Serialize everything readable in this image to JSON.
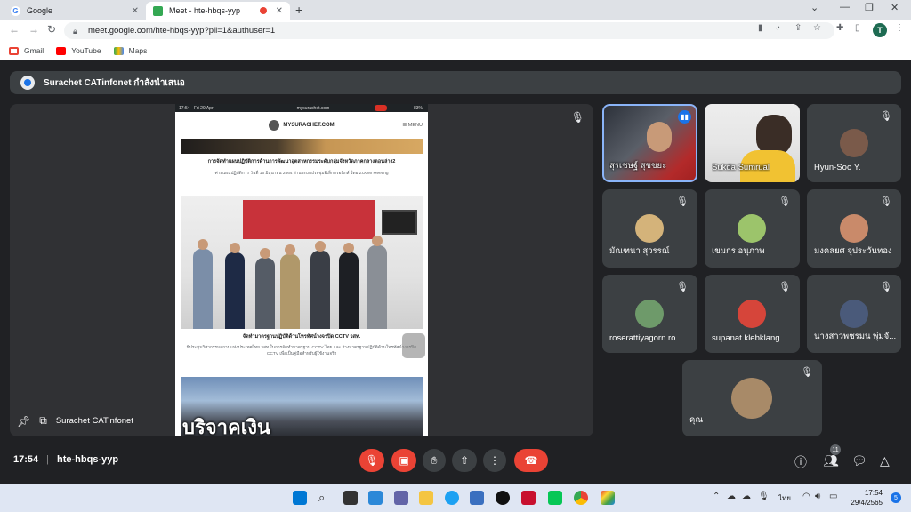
{
  "browser": {
    "tabs": [
      {
        "title": "Google",
        "active": false
      },
      {
        "title": "Meet - hte-hbqs-yyp",
        "active": true
      }
    ],
    "url": "meet.google.com/hte-hbqs-yyp?pli=1&authuser=1",
    "profile_initial": "T",
    "bookmarks": [
      "Gmail",
      "YouTube",
      "Maps"
    ]
  },
  "meet": {
    "presenting_banner": "Surachet CATinfonet กำลังนำเสนอ",
    "presenter_name": "Surachet CATinfonet",
    "shared_screen": {
      "status_time": "17:54 · Fri 29 Apr",
      "status_url": "mysurachet.com",
      "status_battery": "83%",
      "site_name": "MYSURACHET.COM",
      "menu": "MENU",
      "article1_title": "การจัดทำแผนปฏิบัติการด้านการพัฒนาอุตสาหกรรมระดับกลุ่มจังหวัดภาคกลางตอนล่าง2",
      "article1_sub": "ค่ายแผนปฏิบัติการ วันที่ 15 มิถุนายน 2564 ผ่านระบบประชุมอิเล็กทรอนิกส์ โดย ZOOM Meeting",
      "article2_title": "จัดทำมาตรฐานปฏิบัติด้านโทรทัศน์วงจรปิด CCTV วสท.",
      "article2_sub": "ที่ประชุมวิศวกรรมสถานแห่งประเทศไทย วสท.ในการจัดทำมาตรฐาน CCTV ไทย และ ร่างมาตรฐานปฏิบัติด้านโทรทัศน์วงจรปิด CCTV เพื่อเป็นคู่มือสำหรับผู้ใช้งานจริง",
      "banner_caption": "บริจาคเงิน"
    },
    "participants": [
      {
        "name": "สุรเชษฐ์ สุขขยะ",
        "speaking": true,
        "video": true
      },
      {
        "name": "Sukda Sumrual",
        "speaking": false,
        "video": true
      },
      {
        "name": "Hyun-Soo Y.",
        "speaking": false,
        "video": false
      },
      {
        "name": "มัณฑนา สุวรรณ์",
        "speaking": false,
        "video": false
      },
      {
        "name": "เขมกร อนุภาพ",
        "speaking": false,
        "video": false
      },
      {
        "name": "มงคลยศ จุประวันทอง",
        "speaking": false,
        "video": false
      },
      {
        "name": "roserattiyagorn ro...",
        "speaking": false,
        "video": false
      },
      {
        "name": "supanat klebklang",
        "speaking": false,
        "video": false
      },
      {
        "name": "นางสาวพชรมน พุ่มจั...",
        "speaking": false,
        "video": false
      },
      {
        "name": "คุณ",
        "speaking": false,
        "video": false
      }
    ],
    "bottom": {
      "time": "17:54",
      "meeting_code": "hte-hbqs-yyp",
      "people_count": "11"
    }
  },
  "taskbar": {
    "language": "ไทย",
    "time": "17:54",
    "date": "29/4/2565",
    "notifications": "5"
  },
  "colors": {
    "meet_bg": "#202124",
    "tile_bg": "#3c4043",
    "end_call_red": "#ea4335",
    "speaking_blue": "#1a73e8"
  }
}
